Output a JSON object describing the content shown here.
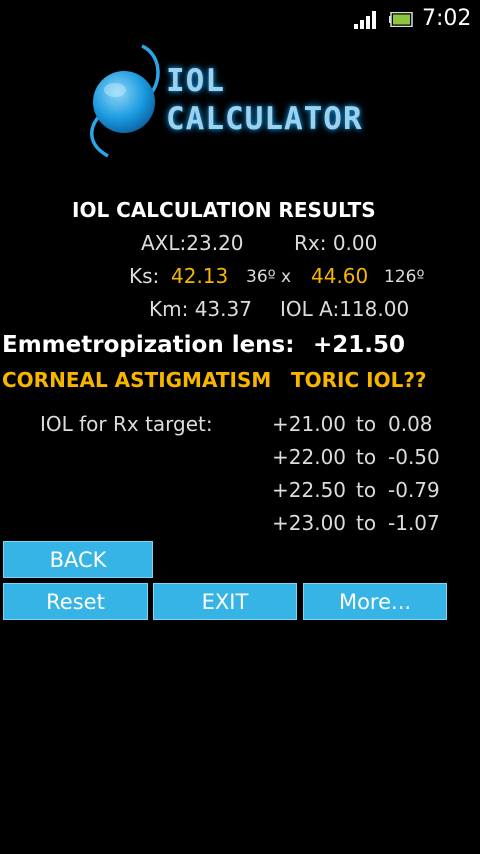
{
  "status": {
    "time": "7:02",
    "signal_icon": "signal-bars-icon",
    "battery_icon": "battery-icon"
  },
  "logo": {
    "line1": "IOL",
    "line2": "CALCULATOR"
  },
  "results": {
    "title": "IOL CALCULATION RESULTS",
    "axl": "AXL:23.20",
    "rx": "Rx:  0.00",
    "ks_label": "Ks:",
    "k1": "42.13",
    "k1_axis": "36º x",
    "k2": "44.60",
    "k2_axis": "126º",
    "km": "Km: 43.37",
    "iol_a": "IOL A:118.00",
    "emm_label": "Emmetropization lens:",
    "emm_value": "+21.50",
    "astig": "CORNEAL ASTIGMATISM",
    "toric": "TORIC IOL??",
    "rx_target_label": "IOL for Rx target:",
    "targets": [
      {
        "iol": "+21.00",
        "to": "to",
        "rx": "0.08"
      },
      {
        "iol": "+22.00",
        "to": "to",
        "rx": "-0.50"
      },
      {
        "iol": "+22.50",
        "to": "to",
        "rx": "-0.79"
      },
      {
        "iol": "+23.00",
        "to": "to",
        "rx": "-1.07"
      }
    ]
  },
  "buttons": {
    "back": "BACK",
    "reset": "Reset",
    "exit": "EXIT",
    "more": "More..."
  },
  "colors": {
    "accent_blue": "#36b4e5",
    "highlight_orange": "#f7b500"
  }
}
